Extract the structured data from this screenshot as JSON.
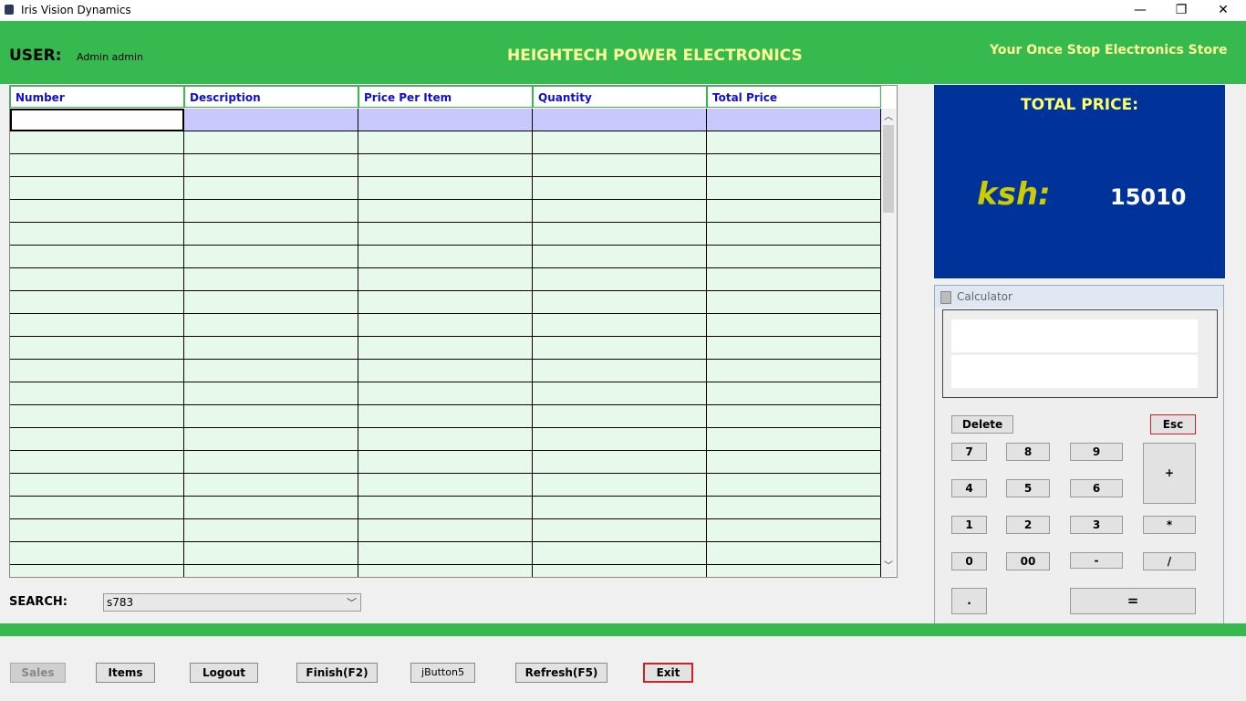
{
  "window": {
    "title": "Iris Vision Dynamics",
    "minimize": "—",
    "restore": "❐",
    "close": "✕"
  },
  "header": {
    "user_label": "USER:",
    "user_name": "Admin admin",
    "company": "HEIGHTECH POWER ELECTRONICS",
    "slogan": "Your Once Stop Electronics Store"
  },
  "table": {
    "columns": [
      "Number",
      "Description",
      "Price Per Item",
      "Quantity",
      "Total Price"
    ],
    "row_count": 21,
    "selected_row": 0
  },
  "search": {
    "label": "SEARCH:",
    "value": "s783"
  },
  "total": {
    "title": "TOTAL PRICE:",
    "currency": "ksh:",
    "value": "15010"
  },
  "calculator": {
    "title": "Calculator",
    "delete": "Delete",
    "esc": "Esc",
    "keys": [
      "7",
      "8",
      "9",
      "+",
      "4",
      "5",
      "6",
      "1",
      "2",
      "3",
      "*",
      "0",
      "00",
      "-",
      "/",
      ".",
      "="
    ]
  },
  "bottom_buttons": {
    "sales": "Sales",
    "items": "Items",
    "logout": "Logout",
    "finish": "Finish(F2)",
    "jbutton5": "jButton5",
    "refresh": "Refresh(F5)",
    "exit": "Exit"
  },
  "colors": {
    "header_green": "#36b94e",
    "header_text": "#ffff99",
    "total_panel": "#003399",
    "table_row": "#e6f9ea",
    "selected_row": "#c8c8ff",
    "column_header_text": "#1010cc"
  }
}
